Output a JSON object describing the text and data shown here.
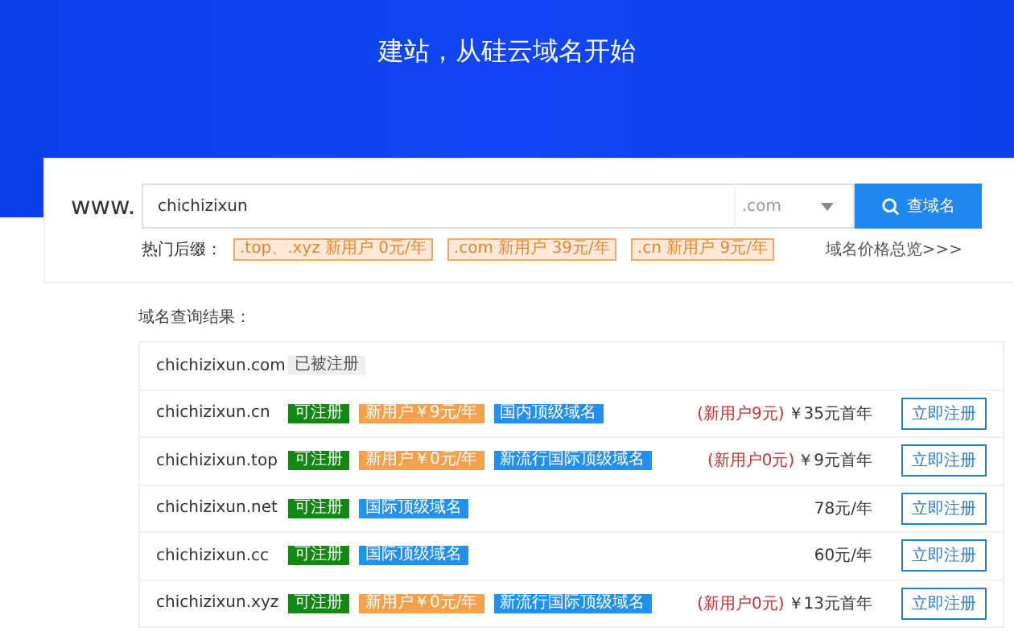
{
  "banner": {
    "title": "建站，从硅云域名开始"
  },
  "search": {
    "prefix": "www.",
    "value": "chichizixun",
    "suffix": ".com",
    "button": "查域名"
  },
  "hot": {
    "label": "热门后缀：",
    "items": [
      ".top、.xyz 新用户 0元/年",
      ".com 新用户 39元/年",
      ".cn 新用户 9元/年"
    ],
    "link": "域名价格总览>>>"
  },
  "results": {
    "title": "域名查询结果：",
    "rows": [
      {
        "domain": "chichizixun.com",
        "tags": [
          {
            "kind": "taken",
            "text": "已被注册"
          }
        ]
      },
      {
        "domain": "chichizixun.cn",
        "tags": [
          {
            "kind": "available",
            "text": "可注册"
          },
          {
            "kind": "promo",
            "text": "新用户￥9元/年"
          },
          {
            "kind": "category",
            "text": "国内顶级域名"
          }
        ],
        "note": "(新用户9元)",
        "price": "￥35元首年",
        "button": "立即注册"
      },
      {
        "domain": "chichizixun.top",
        "tags": [
          {
            "kind": "available",
            "text": "可注册"
          },
          {
            "kind": "promo",
            "text": "新用户￥0元/年"
          },
          {
            "kind": "category",
            "text": "新流行国际顶级域名"
          }
        ],
        "note": "(新用户0元)",
        "price": "￥9元首年",
        "button": "立即注册"
      },
      {
        "domain": "chichizixun.net",
        "tags": [
          {
            "kind": "available",
            "text": "可注册"
          },
          {
            "kind": "category",
            "text": "国际顶级域名"
          }
        ],
        "price": "78元/年",
        "button": "立即注册"
      },
      {
        "domain": "chichizixun.cc",
        "tags": [
          {
            "kind": "available",
            "text": "可注册"
          },
          {
            "kind": "category",
            "text": "国际顶级域名"
          }
        ],
        "price": "60元/年",
        "button": "立即注册"
      },
      {
        "domain": "chichizixun.xyz",
        "tags": [
          {
            "kind": "available",
            "text": "可注册"
          },
          {
            "kind": "promo",
            "text": "新用户￥0元/年"
          },
          {
            "kind": "category",
            "text": "新流行国际顶级域名"
          }
        ],
        "note": "(新用户0元)",
        "price": "￥13元首年",
        "button": "立即注册"
      }
    ]
  }
}
